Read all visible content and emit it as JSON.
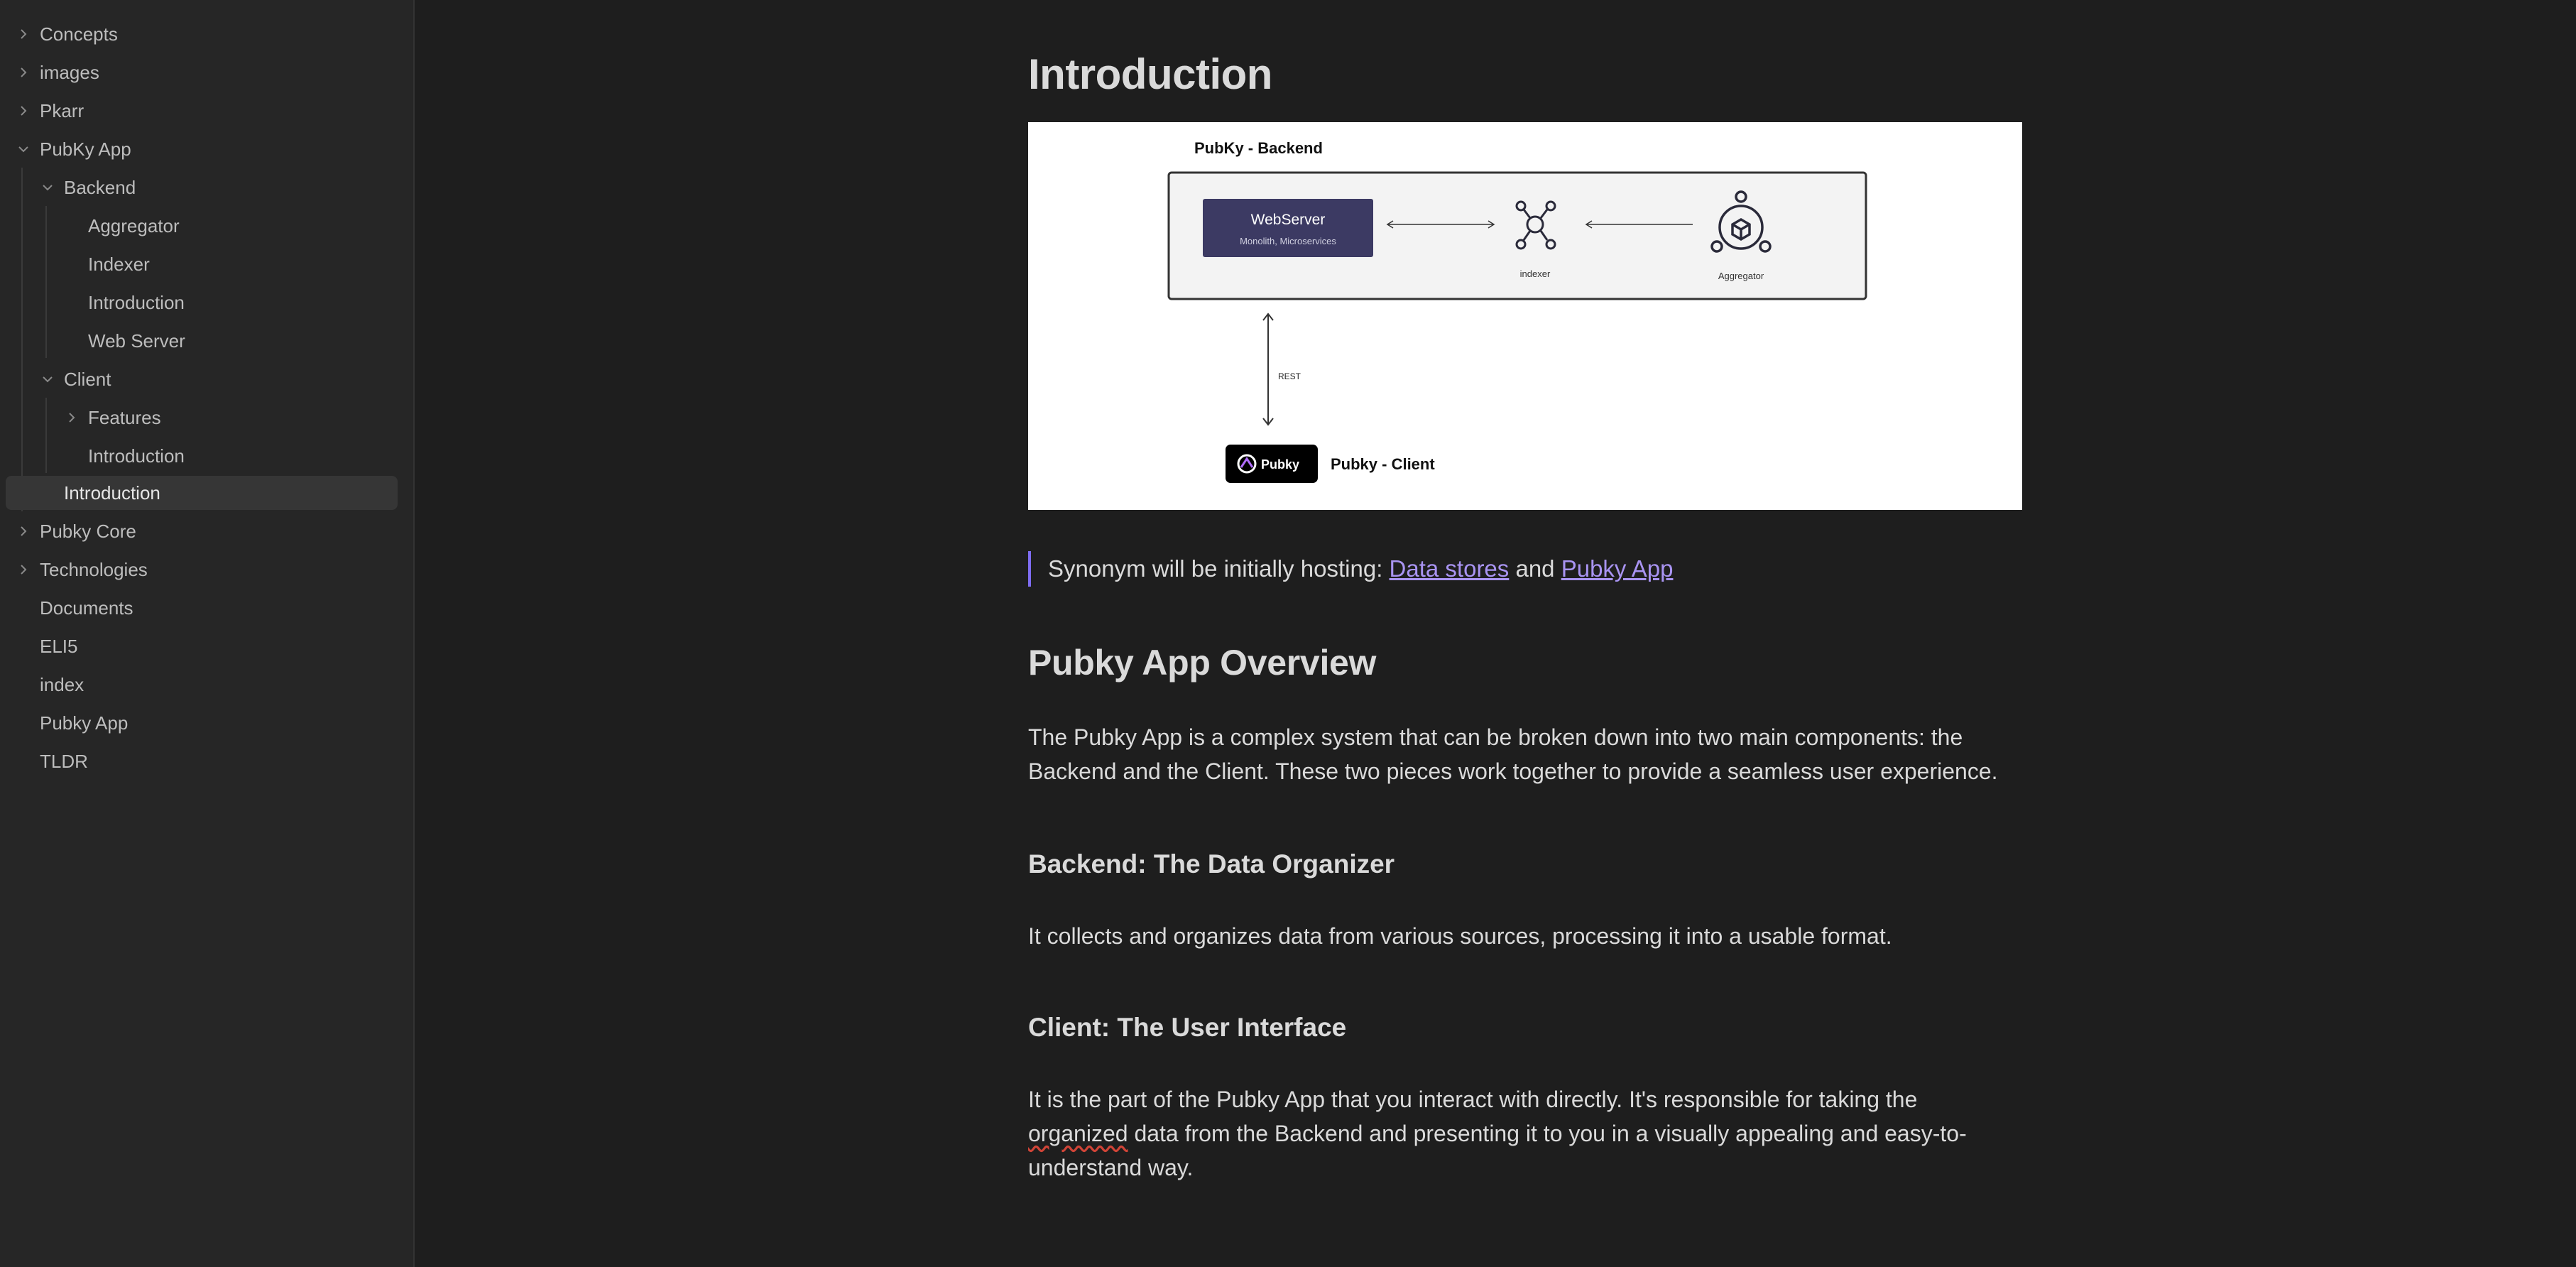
{
  "sidebar": {
    "items": [
      {
        "label": "Concepts",
        "chevron": "right"
      },
      {
        "label": "images",
        "chevron": "right"
      },
      {
        "label": "Pkarr",
        "chevron": "right"
      },
      {
        "label": "PubKy App",
        "chevron": "down"
      },
      {
        "label": "Backend",
        "chevron": "down"
      },
      {
        "label": "Aggregator",
        "chevron": "none"
      },
      {
        "label": "Indexer",
        "chevron": "none"
      },
      {
        "label": "Introduction",
        "chevron": "none"
      },
      {
        "label": "Web Server",
        "chevron": "none"
      },
      {
        "label": "Client",
        "chevron": "down"
      },
      {
        "label": "Features",
        "chevron": "right"
      },
      {
        "label": "Introduction",
        "chevron": "none"
      },
      {
        "label": "Introduction",
        "chevron": "none",
        "active": true
      },
      {
        "label": "Pubky Core",
        "chevron": "right"
      },
      {
        "label": "Technologies",
        "chevron": "right"
      },
      {
        "label": "Documents",
        "chevron": "none"
      },
      {
        "label": "ELI5",
        "chevron": "none"
      },
      {
        "label": "index",
        "chevron": "none"
      },
      {
        "label": "Pubky App",
        "chevron": "none"
      },
      {
        "label": "TLDR",
        "chevron": "none"
      }
    ]
  },
  "document": {
    "title": "Introduction",
    "diagram": {
      "backend_title": "PubKy - Backend",
      "webserver_label": "WebServer",
      "webserver_sub": "Monolith, Microservices",
      "indexer_label": "indexer",
      "aggregator_label": "Aggregator",
      "rest_label": "REST",
      "pubky_badge": "Pubky",
      "client_title": "Pubky - Client"
    },
    "callout": {
      "prefix": "Synonym will be initially hosting: ",
      "link1": "Data stores",
      "middle": " and ",
      "link2": "Pubky App"
    },
    "overview_heading": "Pubky App Overview",
    "overview_text": "The Pubky App is a complex system that can be broken down into two main components: the Backend and the Client. These two pieces work together to provide a seamless user experience.",
    "backend_heading": "Backend: The Data Organizer",
    "backend_text": "It collects and organizes data from various sources, processing it into a usable format.",
    "client_heading": "Client: The User Interface",
    "client_text_1": "It is the part of the Pubky App that you interact with directly. It's responsible for taking the",
    "client_text_misspelled": "organized",
    "client_text_2": " data from the Backend and presenting it to you in a visually appealing and easy-to-understand way."
  },
  "colors": {
    "background": "#1e1e1e",
    "sidebar": "#262626",
    "accent": "#7f6df2",
    "link": "#a994f2",
    "webserver_box": "#3c3a63"
  }
}
